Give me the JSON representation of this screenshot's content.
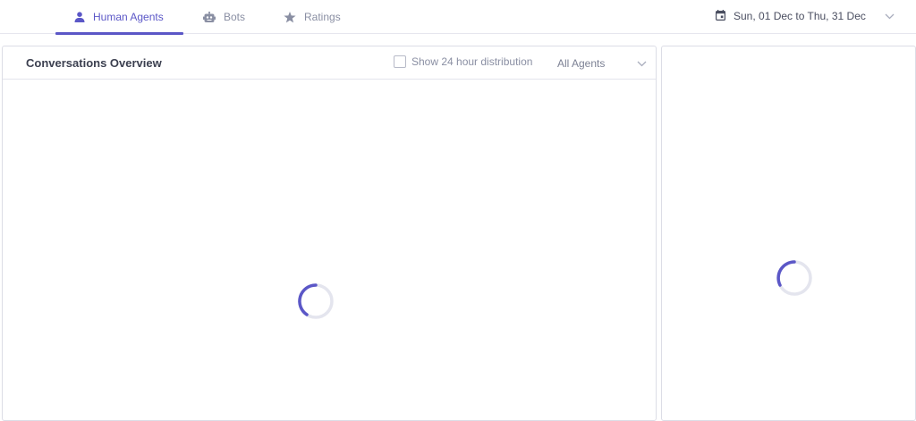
{
  "tabs": [
    {
      "label": "Human Agents",
      "icon": "person-icon",
      "active": true
    },
    {
      "label": "Bots",
      "icon": "robot-icon",
      "active": false
    },
    {
      "label": "Ratings",
      "icon": "star-icon",
      "active": false
    }
  ],
  "date_range": {
    "label": "Sun, 01 Dec to Thu, 31 Dec",
    "icon": "calendar-icon"
  },
  "overview": {
    "title": "Conversations Overview",
    "toggle_label": "Show 24 hour distribution",
    "toggle_checked": false,
    "agent_filter": "All Agents"
  },
  "colors": {
    "accent": "#5b57c7",
    "spinner_track": "#e4e5ee",
    "muted_text": "#8a8fa3"
  }
}
